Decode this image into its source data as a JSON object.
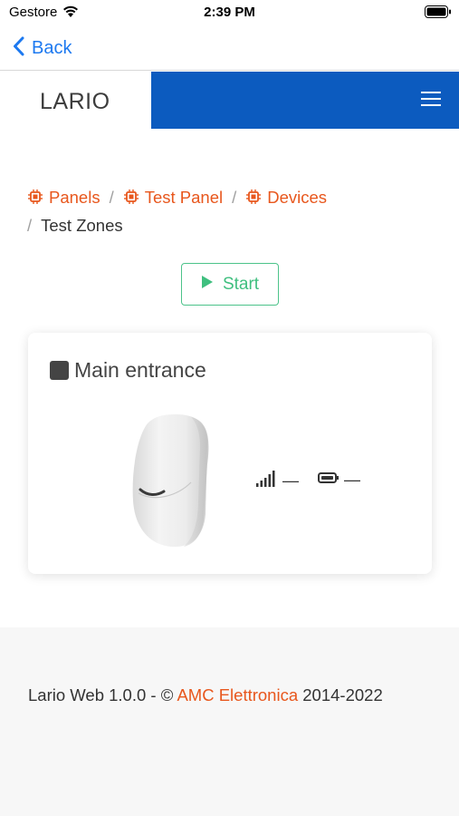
{
  "status_bar": {
    "carrier": "Gestore",
    "time": "2:39 PM"
  },
  "nav": {
    "back_label": "Back"
  },
  "header": {
    "logo": "LARIO",
    "brand_color": "#0c5bbf"
  },
  "breadcrumb": {
    "items": [
      {
        "label": "Panels"
      },
      {
        "label": "Test Panel"
      },
      {
        "label": "Devices"
      }
    ],
    "current": "Test Zones",
    "separator": "/",
    "link_color": "#e8571d"
  },
  "actions": {
    "start_label": "Start",
    "start_color": "#3fbf7f"
  },
  "zone": {
    "name": "Main entrance",
    "signal_value": "—",
    "battery_value": "—"
  },
  "footer": {
    "prefix": "Lario Web 1.0.0 - © ",
    "company": "AMC Elettronica",
    "suffix": " 2014-2022"
  }
}
